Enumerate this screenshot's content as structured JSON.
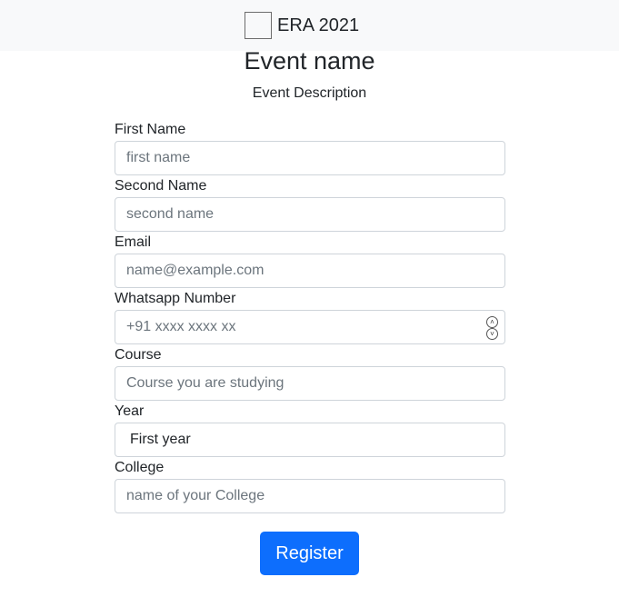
{
  "navbar": {
    "brand": "ERA 2021",
    "logo_icon": "logo-placeholder-icon"
  },
  "event": {
    "title": "Event name",
    "description": "Event Description"
  },
  "form": {
    "first_name": {
      "label": "First Name",
      "placeholder": "first name"
    },
    "second_name": {
      "label": "Second Name",
      "placeholder": "second name"
    },
    "email": {
      "label": "Email",
      "placeholder": "name@example.com"
    },
    "whatsapp": {
      "label": "Whatsapp Number",
      "placeholder": "+91 xxxx xxxx xx"
    },
    "course": {
      "label": "Course",
      "placeholder": "Course you are studying"
    },
    "year": {
      "label": "Year",
      "value": "First year"
    },
    "college": {
      "label": "College",
      "placeholder": "name of your College"
    },
    "submit_label": "Register"
  },
  "colors": {
    "primary": "#0d6efd",
    "navbar_bg": "#f8f9fa",
    "border": "#ced4da"
  }
}
